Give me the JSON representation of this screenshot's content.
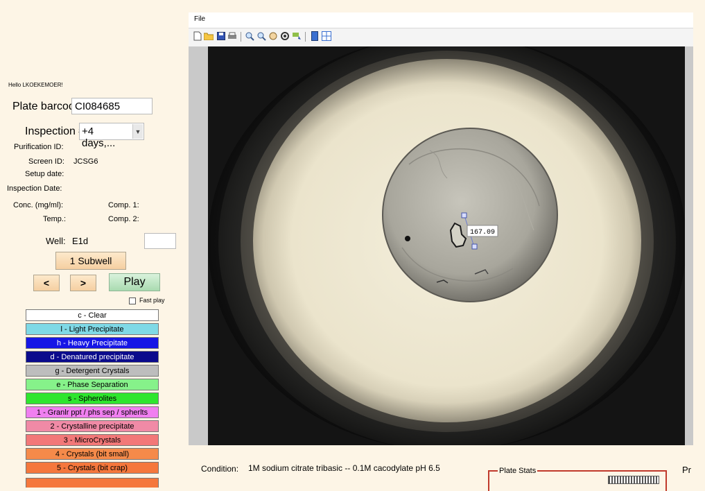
{
  "user": {
    "greeting": "Hello LKOEKEMOER!"
  },
  "form": {
    "plate_barcode_label": "Plate barcode:",
    "plate_barcode_value": "CI084685",
    "inspection_label": "Inspection #:",
    "inspection_value": "+4 days,...",
    "purification_label": "Purification ID:",
    "screen_label": "Screen ID:",
    "screen_value": "JCSG6",
    "setup_date_label": "Setup date:",
    "inspection_date_label": "Inspection Date:",
    "conc_label": "Conc. (mg/ml):",
    "comp1_label": "Comp. 1:",
    "temp_label": "Temp.:",
    "comp2_label": "Comp. 2:",
    "well_label": "Well:",
    "well_value": "E1d"
  },
  "controls": {
    "subwell_button": "1 Subwell",
    "prev_button": "<",
    "next_button": ">",
    "play_button": "Play",
    "fast_play_label": "Fast play"
  },
  "categories": [
    {
      "label": "c - Clear",
      "bg": "#ffffff",
      "fg": "#000000"
    },
    {
      "label": "l - Light Precipitate",
      "bg": "#7fd9e6",
      "fg": "#000000"
    },
    {
      "label": "h - Heavy Precipitate",
      "bg": "#1616e6",
      "fg": "#ffffff"
    },
    {
      "label": "d - Denatured precipitate",
      "bg": "#0b0b8c",
      "fg": "#ffffff"
    },
    {
      "label": "g - Detergent Crystals",
      "bg": "#bdbdbd",
      "fg": "#000000"
    },
    {
      "label": "e - Phase Separation",
      "bg": "#86f28a",
      "fg": "#000000"
    },
    {
      "label": "s - Spherolites",
      "bg": "#2ee62e",
      "fg": "#000000"
    },
    {
      "label": "1 - Granlr ppt / phs sep / spherlts",
      "bg": "#f07ff0",
      "fg": "#000000"
    },
    {
      "label": "2 - Crystalline precipitate",
      "bg": "#f08aa6",
      "fg": "#000000"
    },
    {
      "label": "3 - MicroCrystals",
      "bg": "#f27878",
      "fg": "#000000"
    },
    {
      "label": "4 - Crystals (bit small)",
      "bg": "#f58a4a",
      "fg": "#000000"
    },
    {
      "label": "5 - Crystals (bit crap)",
      "bg": "#f5773c",
      "fg": "#000000"
    }
  ],
  "menu": {
    "file": "File"
  },
  "toolbar_icons": [
    "new-icon",
    "open-folder-icon",
    "save-icon",
    "print-icon",
    "zoom-in-icon",
    "zoom-out-icon",
    "pan-hand-icon",
    "rotate-icon",
    "measure-icon",
    "panel-icon",
    "grid-icon"
  ],
  "measurement": {
    "value": "167.09"
  },
  "condition": {
    "label": "Condition:",
    "value": "1M sodium citrate tribasic -- 0.1M cacodylate pH 6.5"
  },
  "plate_stats": {
    "title": "Plate Stats"
  },
  "truncated_label": "Pr"
}
